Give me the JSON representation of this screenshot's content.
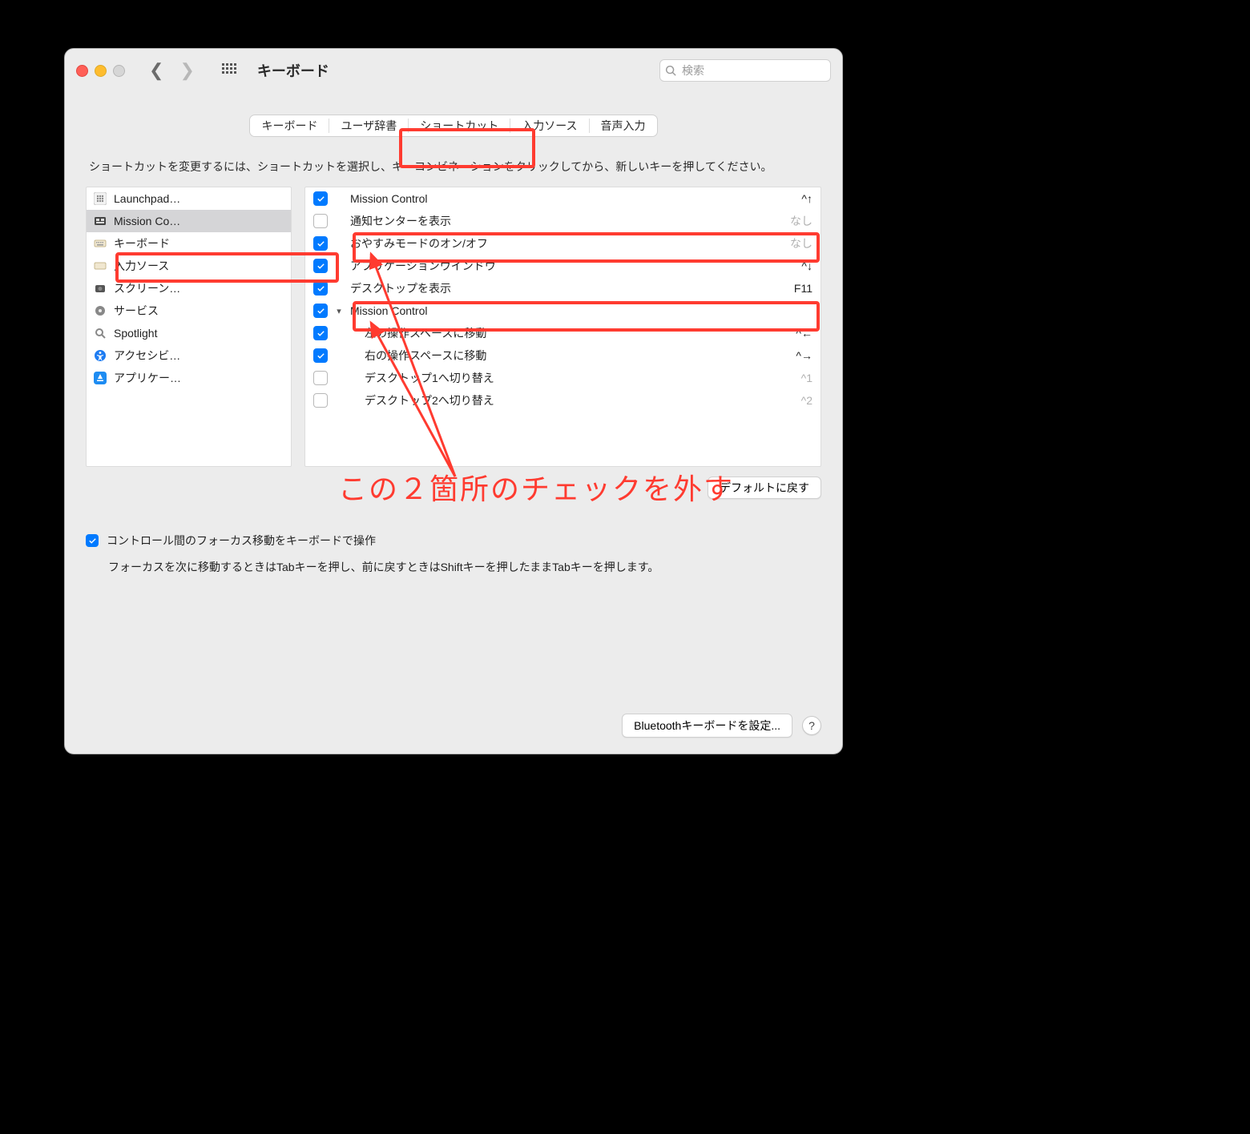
{
  "window": {
    "title": "キーボード",
    "search_placeholder": "検索"
  },
  "tabs": [
    {
      "label": "キーボード"
    },
    {
      "label": "ユーザ辞書"
    },
    {
      "label": "ショートカット",
      "active": true
    },
    {
      "label": "入力ソース"
    },
    {
      "label": "音声入力"
    }
  ],
  "hint": "ショートカットを変更するには、ショートカットを選択し、キーコンビネーションをクリックしてから、新しいキーを押してください。",
  "categories": [
    {
      "label": "Launchpad…",
      "icon": "launchpad-icon",
      "selected": false,
      "icon_svg": "launchpad"
    },
    {
      "label": "Mission Co…",
      "icon": "mission-control-icon",
      "selected": true,
      "icon_svg": "mission"
    },
    {
      "label": "キーボード",
      "icon": "keyboard-icon",
      "selected": false,
      "icon_svg": "keyboard"
    },
    {
      "label": "入力ソース",
      "icon": "input-icon",
      "selected": false,
      "icon_svg": "input"
    },
    {
      "label": "スクリーン…",
      "icon": "screenshot-icon",
      "selected": false,
      "icon_svg": "screenshot"
    },
    {
      "label": "サービス",
      "icon": "services-icon",
      "selected": false,
      "icon_svg": "gear"
    },
    {
      "label": "Spotlight",
      "icon": "spotlight-icon",
      "selected": false,
      "icon_svg": "spotlight"
    },
    {
      "label": "アクセシビ…",
      "icon": "accessibility-icon",
      "selected": false,
      "icon_svg": "a11y"
    },
    {
      "label": "アプリケー…",
      "icon": "app-icon",
      "selected": false,
      "icon_svg": "appstore"
    }
  ],
  "shortcuts": [
    {
      "checked": true,
      "label": "Mission Control",
      "key": "^↑",
      "indent": 0,
      "disabled": false
    },
    {
      "checked": false,
      "label": "通知センターを表示",
      "key": "なし",
      "indent": 0,
      "disabled": true
    },
    {
      "checked": true,
      "label": "おやすみモードのオン/オフ",
      "key": "なし",
      "indent": 0,
      "disabled": true
    },
    {
      "checked": true,
      "label": "アプリケーションウインドウ",
      "key": "^↓",
      "indent": 0,
      "disabled": false
    },
    {
      "checked": true,
      "label": "デスクトップを表示",
      "key": "F11",
      "indent": 0,
      "disabled": false
    },
    {
      "checked": true,
      "label": "Mission Control",
      "key": "",
      "indent": 0,
      "disabled": false,
      "disclosure": true
    },
    {
      "checked": true,
      "label": "左の操作スペースに移動",
      "key": "^←",
      "indent": 1,
      "disabled": false
    },
    {
      "checked": true,
      "label": "右の操作スペースに移動",
      "key": "^→",
      "indent": 1,
      "disabled": false
    },
    {
      "checked": false,
      "label": "デスクトップ1へ切り替え",
      "key": "^1",
      "indent": 1,
      "disabled": true
    },
    {
      "checked": false,
      "label": "デスクトップ2へ切り替え",
      "key": "^2",
      "indent": 1,
      "disabled": true
    }
  ],
  "restore_label": "デフォルトに戻す",
  "focus_label": "コントロール間のフォーカス移動をキーボードで操作",
  "focus_hint": "フォーカスを次に移動するときはTabキーを押し、前に戻すときはShiftキーを押したままTabキーを押します。",
  "bt_button": "Bluetoothキーボードを設定...",
  "help": "?",
  "annotation_text": "この２箇所のチェックを外す"
}
